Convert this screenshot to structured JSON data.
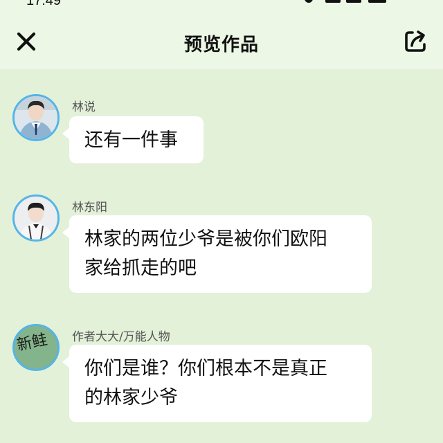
{
  "status_bar": {
    "time": "17:49"
  },
  "header": {
    "title": "预览作品",
    "close_icon": "close-icon",
    "share_icon": "share-icon"
  },
  "colors": {
    "chat_background": "#e2f1d8",
    "header_background": "#ecf7e6",
    "avatar_border": "#54b4e8",
    "bubble": "#ffffff"
  },
  "messages": [
    {
      "sender": "林说",
      "avatar": "avatar-boy-uniform",
      "lines": [
        "还有一件事"
      ]
    },
    {
      "sender": "林东阳",
      "avatar": "avatar-boy-suspenders",
      "lines": [
        "林家的两位少爷是被你们欧阳",
        "家给抓走的吧"
      ]
    },
    {
      "sender": "作者大大/万能人物",
      "avatar": "avatar-xinlu-logo",
      "avatar_text": "新鲑",
      "lines": [
        "你们是谁？你们根本不是真正",
        "的林家少爷"
      ]
    }
  ]
}
